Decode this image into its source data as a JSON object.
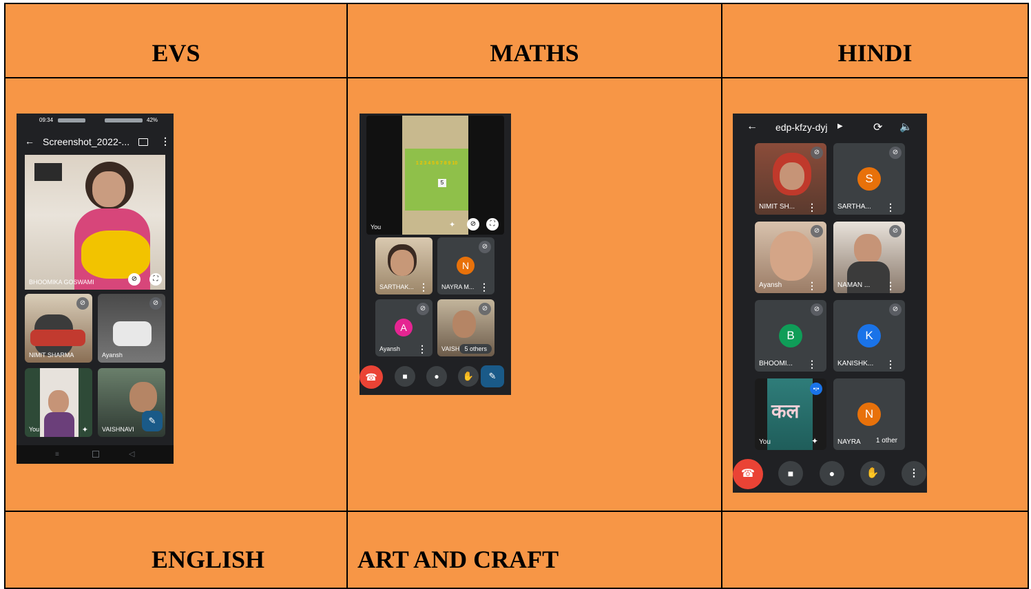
{
  "table": {
    "headers": [
      "EVS",
      "MATHS",
      "HINDI"
    ],
    "bottom": [
      "ENGLISH",
      "ART AND CRAFT",
      ""
    ]
  },
  "evs_phone": {
    "status_time": "09:34",
    "status_right": "42%",
    "title": "Screenshot_2022-...",
    "tiles": [
      {
        "name": "BHOOMIKA GOSWAMI"
      },
      {
        "name": "NIMIT SHARMA"
      },
      {
        "name": "Ayansh"
      },
      {
        "name": "You"
      },
      {
        "name": "VAISHNAVI"
      }
    ]
  },
  "maths_phone": {
    "self_label": "You",
    "board_numbers": "1 2 3 4 5 6 7 8 9 10",
    "board_card": "5",
    "tiles": [
      {
        "name": "SARTHAK..."
      },
      {
        "name": "NAYRA M...",
        "initial": "N",
        "color": "#e8710a"
      },
      {
        "name": "Ayansh",
        "initial": "A",
        "color": "#e52592"
      },
      {
        "name": "VAISH",
        "badge": "5 others"
      }
    ]
  },
  "hindi_phone": {
    "meeting_code": "edp-kfzy-dyj",
    "tiles": [
      {
        "name": "NIMIT SH..."
      },
      {
        "name": "SARTHA...",
        "initial": "S",
        "color": "#e8710a"
      },
      {
        "name": "Ayansh"
      },
      {
        "name": "NAMAN ..."
      },
      {
        "name": "BHOOMI...",
        "initial": "B",
        "color": "#0f9d58"
      },
      {
        "name": "KANISHK...",
        "initial": "K",
        "color": "#1a73e8"
      },
      {
        "name": "You",
        "word": "कल"
      },
      {
        "name": "NAYRA",
        "initial": "N",
        "color": "#e8710a",
        "badge": "1 other"
      }
    ]
  },
  "colors": {
    "cell_bg": "#f79646",
    "meet_bg": "#202124",
    "tile_bg": "#3c4043",
    "end_call": "#ea4335"
  }
}
